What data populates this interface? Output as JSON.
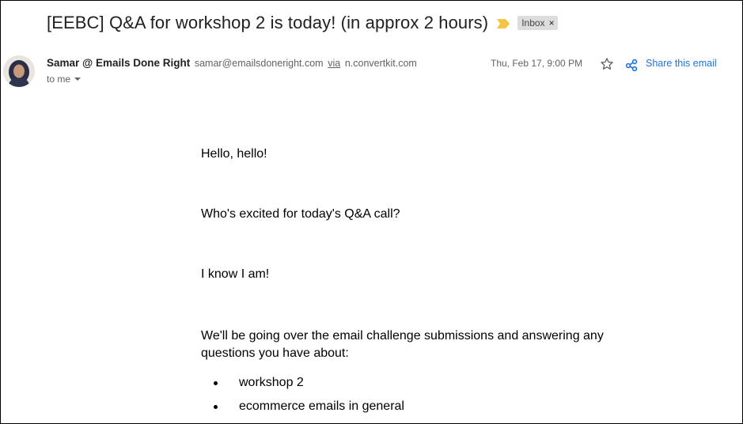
{
  "subject": "[EEBC] Q&A for workshop 2 is today! (in approx 2 hours)",
  "label": {
    "text": "Inbox",
    "remove": "×"
  },
  "sender": {
    "name": "Samar @ Emails Done Right",
    "email": "samar@emailsdoneright.com",
    "via_label": "via",
    "via_domain": "n.convertkit.com",
    "to": "to me"
  },
  "date": "Thu, Feb 17, 9:00 PM",
  "actions": {
    "share": "Share this email"
  },
  "body": {
    "paragraphs": [
      "Hello, hello!",
      "Who's excited for today's Q&A call?",
      "I know I am!",
      "We'll be going over the email challenge submissions and answering any questions you have about:"
    ],
    "bullets": [
      "workshop 2",
      "ecommerce emails in general"
    ]
  },
  "colors": {
    "importance_marker": "#f4c542",
    "link": "#1a73e8",
    "chip_bg": "#dddddd"
  },
  "icons": [
    "importance-marker-icon",
    "close-icon",
    "chevron-down-icon",
    "star-icon",
    "share-icon"
  ]
}
